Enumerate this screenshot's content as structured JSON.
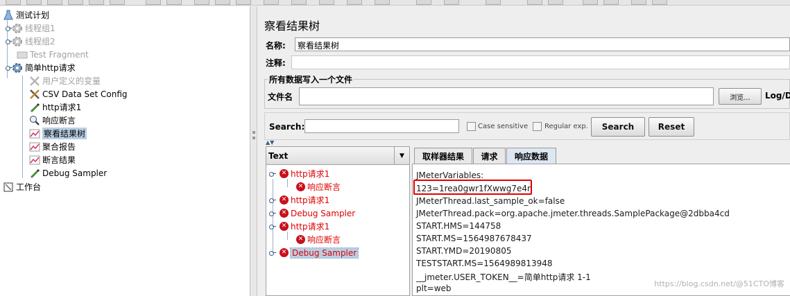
{
  "left_tree": {
    "items": [
      {
        "label": "测试计划"
      },
      {
        "label": "线程组1"
      },
      {
        "label": "线程组2"
      },
      {
        "label": "Test Fragment"
      },
      {
        "label": "简单http请求"
      },
      {
        "label": "用户定义的变量"
      },
      {
        "label": "CSV Data Set Config"
      },
      {
        "label": "http请求1"
      },
      {
        "label": "响应断言"
      },
      {
        "label": "察看结果树"
      },
      {
        "label": "聚合报告"
      },
      {
        "label": "断言结果"
      },
      {
        "label": "Debug Sampler"
      },
      {
        "label": "工作台"
      }
    ]
  },
  "panel": {
    "title": "察看结果树",
    "name_label": "名称:",
    "name_value": "察看结果树",
    "comment_label": "注释:",
    "comment_value": "",
    "file_group_title": "所有数据写入一个文件",
    "file_label": "文件名",
    "file_value": "",
    "browse_label": "浏览...",
    "log_label": "Log/Di"
  },
  "search": {
    "label": "Search:",
    "value": "",
    "case_sensitive_label": "Case sensitive",
    "regex_label": "Regular exp.",
    "search_button": "Search",
    "reset_button": "Reset"
  },
  "results_tree": {
    "renderer": "Text",
    "items": [
      {
        "label": "http请求1"
      },
      {
        "label": "响应断言"
      },
      {
        "label": "http请求1"
      },
      {
        "label": "Debug Sampler"
      },
      {
        "label": "http请求1"
      },
      {
        "label": "响应断言"
      },
      {
        "label": "Debug Sampler"
      }
    ]
  },
  "tabs": [
    {
      "label": "取样器结果"
    },
    {
      "label": "请求"
    },
    {
      "label": "响应数据"
    }
  ],
  "response_lines": [
    "JMeterVariables:",
    "123=1rea0gwr1fXwwg7e4r",
    "JMeterThread.last_sample_ok=false",
    "JMeterThread.pack=org.apache.jmeter.threads.SamplePackage@2dbba4cd",
    "START.HMS=144758",
    "START.MS=1564987678437",
    "START.YMD=20190805",
    "TESTSTART.MS=1564989813948",
    "__jmeter.USER_TOKEN__=简单http请求 1-1",
    "plt=web"
  ],
  "watermark": "https://blog.csdn.net/@51CTO博客",
  "colors": {
    "error_red": "#e00000",
    "selected_bg": "#b8cfe5",
    "active_tab": "#dde7f2"
  }
}
